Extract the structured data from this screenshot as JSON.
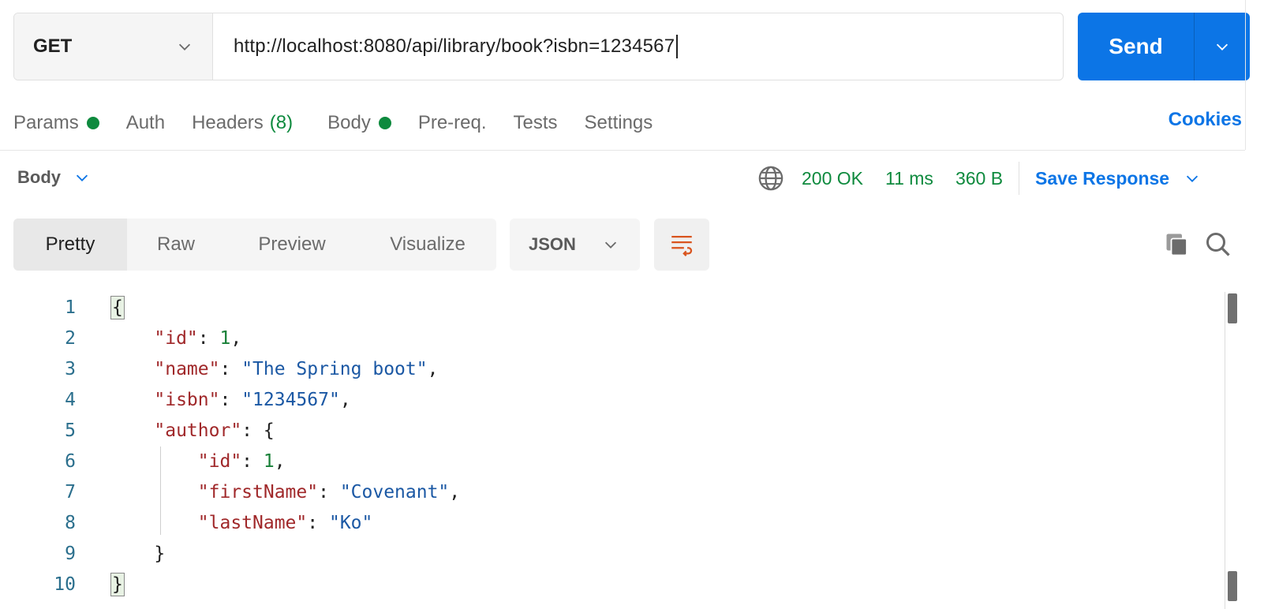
{
  "request": {
    "method": "GET",
    "url": "http://localhost:8080/api/library/book?isbn=1234567",
    "send_label": "Send"
  },
  "request_tabs": [
    {
      "label": "Params",
      "dot": true
    },
    {
      "label": "Auth"
    },
    {
      "label": "Headers",
      "count": "(8)"
    },
    {
      "label": "Body",
      "dot": true
    },
    {
      "label": "Pre-req."
    },
    {
      "label": "Tests"
    },
    {
      "label": "Settings"
    }
  ],
  "cookies_label": "Cookies",
  "response": {
    "body_selector": "Body",
    "status": "200 OK",
    "time": "11 ms",
    "size": "360 B",
    "save_label": "Save Response"
  },
  "view_tabs": [
    "Pretty",
    "Raw",
    "Preview",
    "Visualize"
  ],
  "active_view": "Pretty",
  "format": "JSON",
  "code_lines": [
    "1",
    "2",
    "3",
    "4",
    "5",
    "6",
    "7",
    "8",
    "9",
    "10"
  ],
  "json": {
    "k_id": "\"id\"",
    "v_id": "1",
    "k_name": "\"name\"",
    "v_name": "\"The Spring boot\"",
    "k_isbn": "\"isbn\"",
    "v_isbn": "\"1234567\"",
    "k_author": "\"author\"",
    "k_author_id": "\"id\"",
    "v_author_id": "1",
    "k_first": "\"firstName\"",
    "v_first": "\"Covenant\"",
    "k_last": "\"lastName\"",
    "v_last": "\"Ko\""
  },
  "colors": {
    "accent": "#0c75e6",
    "success": "#0e8a3e",
    "key": "#a0282a",
    "string": "#1b58a4",
    "number": "#188038"
  }
}
